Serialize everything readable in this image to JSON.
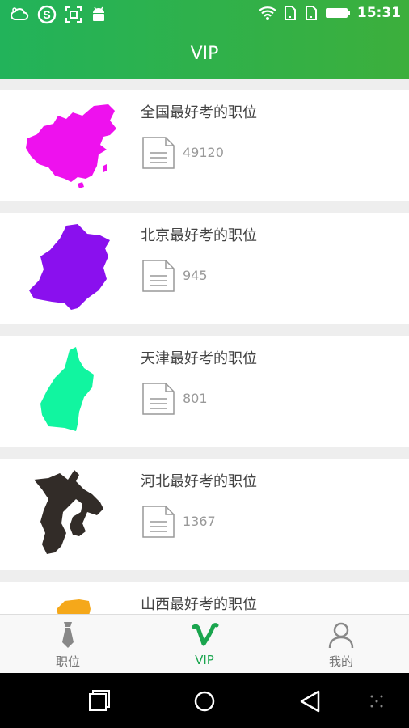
{
  "status": {
    "time": "15:31"
  },
  "app_bar": {
    "title": "VIP"
  },
  "list": [
    {
      "title": "全国最好考的职位",
      "count": "49120",
      "map_color": "#ee11ee",
      "map": "china-map"
    },
    {
      "title": "北京最好考的职位",
      "count": "945",
      "map_color": "#8a10ee",
      "map": "beijing-map"
    },
    {
      "title": "天津最好考的职位",
      "count": "801",
      "map_color": "#11f5a0",
      "map": "tianjin-map"
    },
    {
      "title": "河北最好考的职位",
      "count": "1367",
      "map_color": "#322c28",
      "map": "hebei-map"
    },
    {
      "title": "山西最好考的职位",
      "count": "",
      "map_color": "#f5a81a",
      "map": "shanxi-map"
    }
  ],
  "tabs": [
    {
      "label": "职位",
      "icon": "tie-icon",
      "active": false
    },
    {
      "label": "VIP",
      "icon": "vip-v-icon",
      "active": true
    },
    {
      "label": "我的",
      "icon": "person-icon",
      "active": false
    }
  ],
  "colors": {
    "accent": "#1aa54e",
    "header": "#2db34f"
  }
}
